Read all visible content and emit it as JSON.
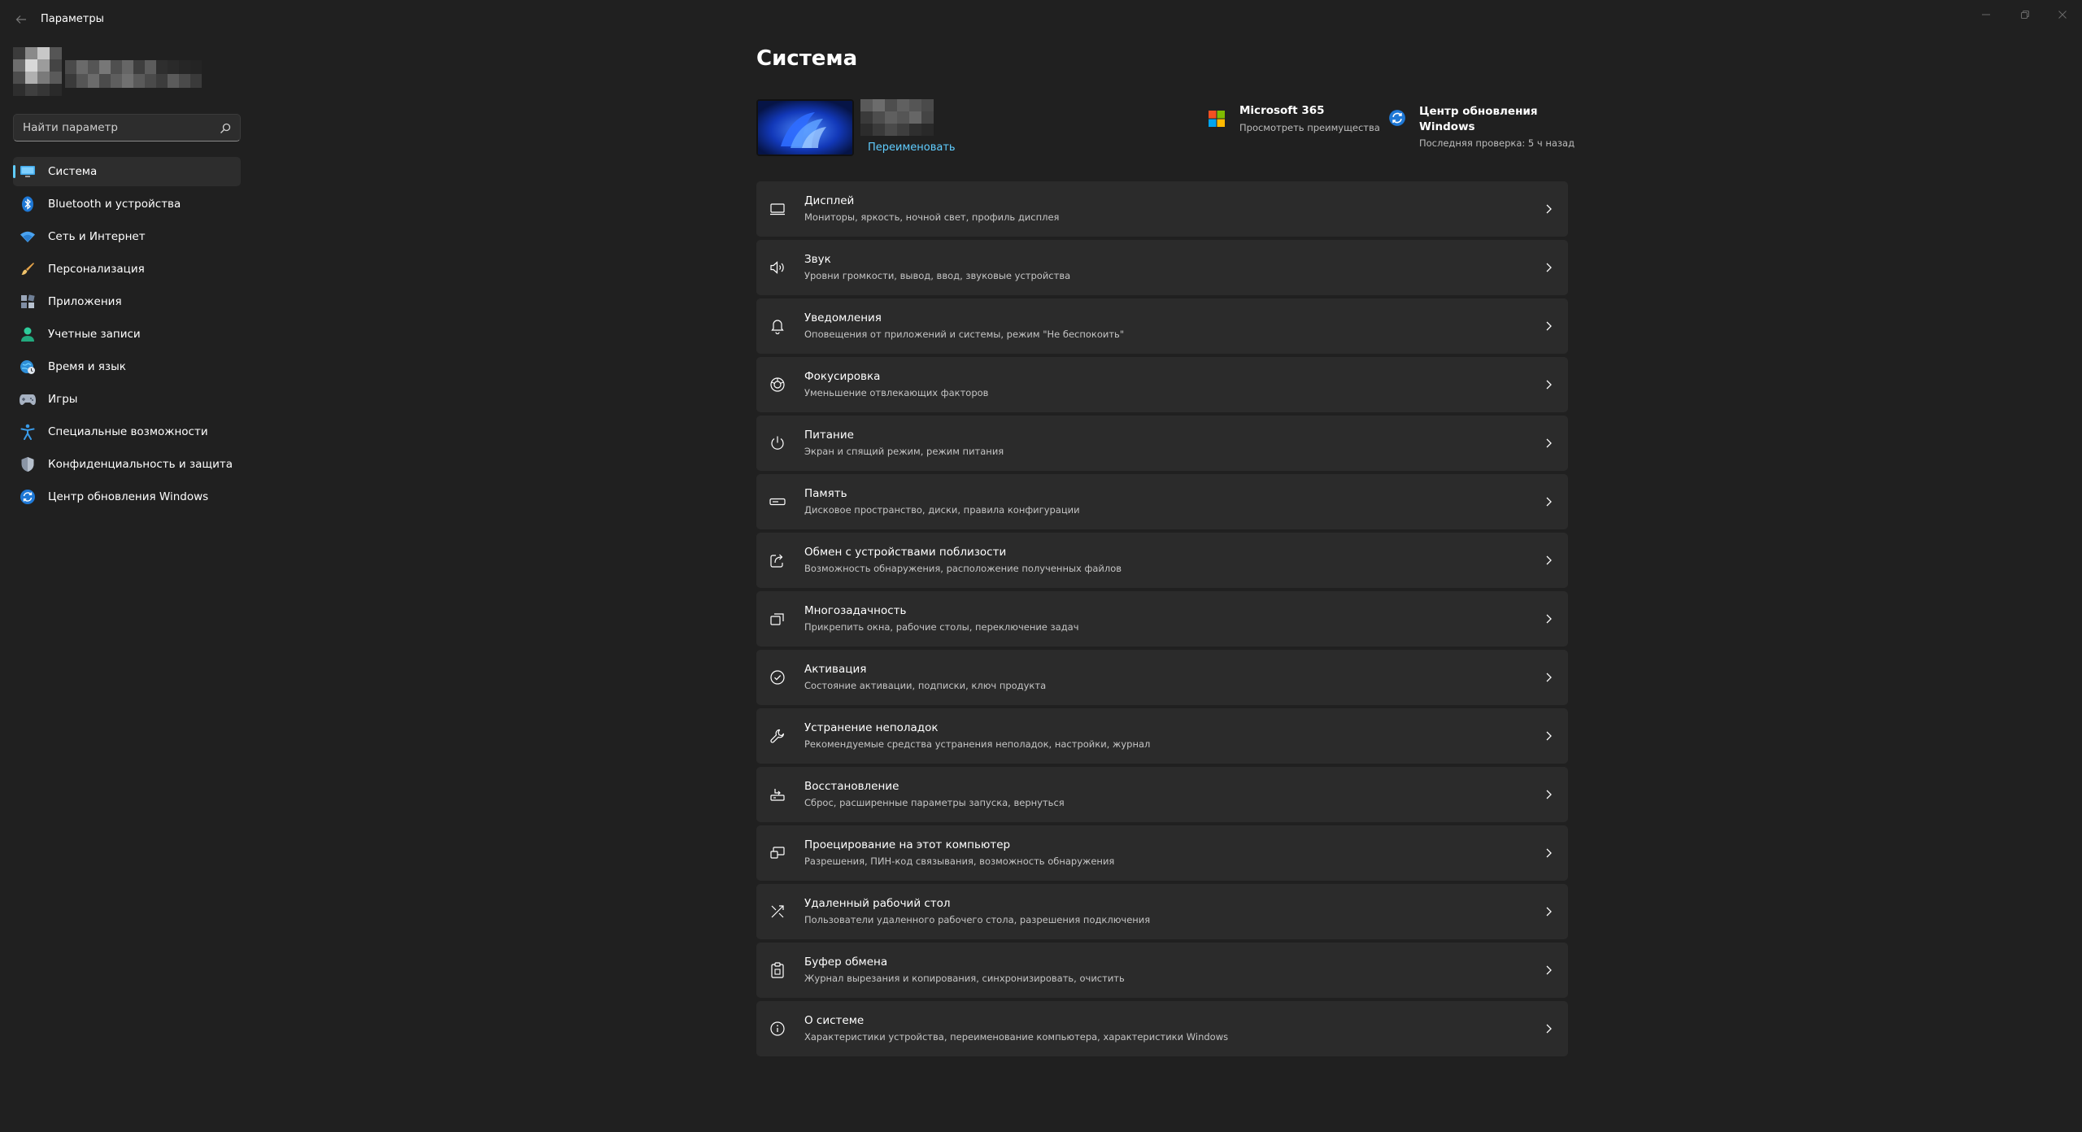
{
  "window": {
    "title": "Параметры"
  },
  "search": {
    "placeholder": "Найти параметр"
  },
  "sidebar": {
    "items": [
      {
        "label": "Система",
        "icon": "monitor-icon",
        "active": true
      },
      {
        "label": "Bluetooth и устройства",
        "icon": "bluetooth-icon"
      },
      {
        "label": "Сеть и Интернет",
        "icon": "wifi-icon"
      },
      {
        "label": "Персонализация",
        "icon": "brush-icon"
      },
      {
        "label": "Приложения",
        "icon": "apps-icon"
      },
      {
        "label": "Учетные записи",
        "icon": "person-icon"
      },
      {
        "label": "Время и язык",
        "icon": "globe-clock-icon"
      },
      {
        "label": "Игры",
        "icon": "gamepad-icon"
      },
      {
        "label": "Специальные возможности",
        "icon": "accessibility-icon"
      },
      {
        "label": "Конфиденциальность и защита",
        "icon": "shield-icon"
      },
      {
        "label": "Центр обновления Windows",
        "icon": "update-icon"
      }
    ]
  },
  "main": {
    "title": "Система",
    "device": {
      "rename": "Переименовать"
    },
    "promos": [
      {
        "title": "Microsoft 365",
        "subtitle": "Просмотреть преимущества",
        "icon": "microsoft-logo-icon"
      },
      {
        "title": "Центр обновления Windows",
        "subtitle": "Последняя проверка: 5 ч назад",
        "icon": "update-icon"
      }
    ],
    "cards": [
      {
        "title": "Дисплей",
        "subtitle": "Мониторы, яркость, ночной свет, профиль дисплея",
        "icon": "display-icon"
      },
      {
        "title": "Звук",
        "subtitle": "Уровни громкости, вывод, ввод, звуковые устройства",
        "icon": "speaker-icon"
      },
      {
        "title": "Уведомления",
        "subtitle": "Оповещения от приложений и системы, режим \"Не беспокоить\"",
        "icon": "bell-icon"
      },
      {
        "title": "Фокусировка",
        "subtitle": "Уменьшение отвлекающих факторов",
        "icon": "focus-icon"
      },
      {
        "title": "Питание",
        "subtitle": "Экран и спящий режим, режим питания",
        "icon": "power-icon"
      },
      {
        "title": "Память",
        "subtitle": "Дисковое пространство, диски, правила конфигурации",
        "icon": "storage-icon"
      },
      {
        "title": "Обмен с устройствами поблизости",
        "subtitle": "Возможность обнаружения, расположение полученных файлов",
        "icon": "share-icon"
      },
      {
        "title": "Многозадачность",
        "subtitle": "Прикрепить окна, рабочие столы, переключение задач",
        "icon": "multitask-icon"
      },
      {
        "title": "Активация",
        "subtitle": "Состояние активации, подписки, ключ продукта",
        "icon": "check-circle-icon"
      },
      {
        "title": "Устранение неполадок",
        "subtitle": "Рекомендуемые средства устранения неполадок, настройки, журнал",
        "icon": "wrench-icon"
      },
      {
        "title": "Восстановление",
        "subtitle": "Сброс, расширенные параметры запуска, вернуться",
        "icon": "recovery-icon"
      },
      {
        "title": "Проецирование на этот компьютер",
        "subtitle": "Разрешения, ПИН-код связывания, возможность обнаружения",
        "icon": "project-icon"
      },
      {
        "title": "Удаленный рабочий стол",
        "subtitle": "Пользователи удаленного рабочего стола, разрешения подключения",
        "icon": "remote-desktop-icon"
      },
      {
        "title": "Буфер обмена",
        "subtitle": "Журнал вырезания и копирования, синхронизировать, очистить",
        "icon": "clipboard-icon"
      },
      {
        "title": "О системе",
        "subtitle": "Характеристики устройства, переименование компьютера, характеристики Windows",
        "icon": "info-icon"
      }
    ]
  },
  "colors": {
    "background": "#202020",
    "card": "#2b2b2b",
    "accent": "#60cdff"
  }
}
